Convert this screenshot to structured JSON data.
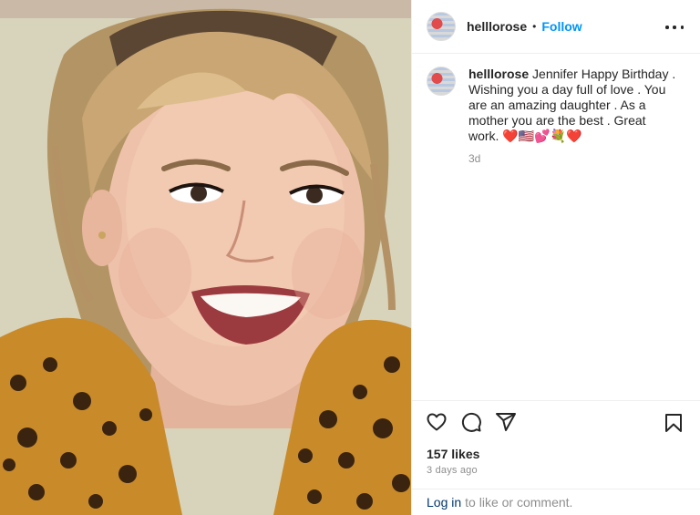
{
  "header": {
    "username": "helllorose",
    "separator": "•",
    "follow_label": "Follow"
  },
  "caption": {
    "username": "helllorose",
    "text": "Jennifer Happy Birthday . Wishing you a day full of love . You are an amazing daughter . As a mother you are the best . Great work. ❤️🇺🇸💕💐❤️",
    "time": "3d"
  },
  "actions": {
    "like_icon": "heart-outline-icon",
    "comment_icon": "comment-bubble-icon",
    "share_icon": "paper-plane-icon",
    "save_icon": "bookmark-icon"
  },
  "stats": {
    "likes": "157 likes",
    "date": "3 days ago"
  },
  "login": {
    "link_text": "Log in",
    "rest_text": "to like or comment."
  },
  "colors": {
    "accent": "#0095f6",
    "link": "#00376b",
    "muted": "#8e8e8e",
    "text": "#262626"
  }
}
